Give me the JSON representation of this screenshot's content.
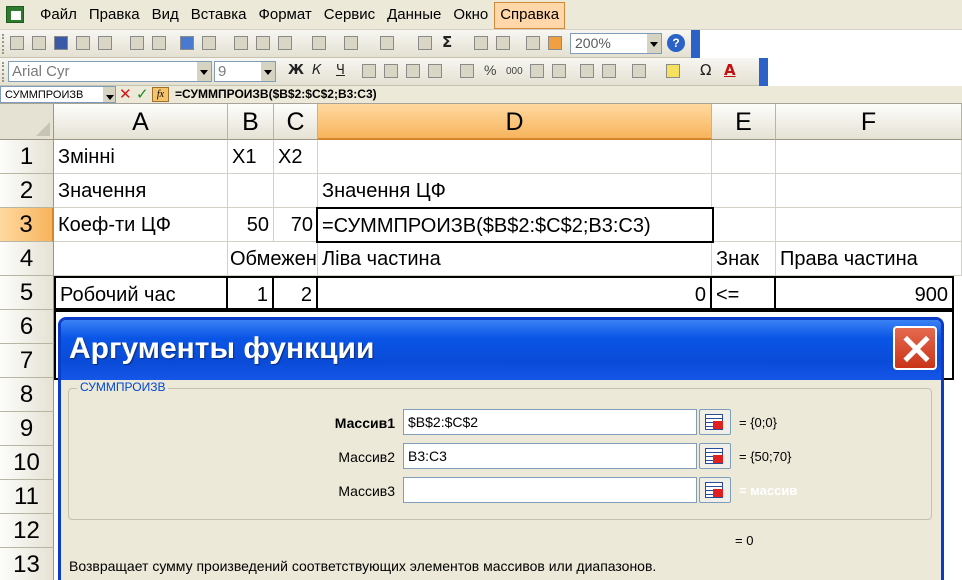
{
  "menu": {
    "items": [
      "Файл",
      "Правка",
      "Вид",
      "Вставка",
      "Формат",
      "Сервис",
      "Данные",
      "Окно",
      "Справка"
    ],
    "active": "Справка"
  },
  "toolbar": {
    "zoom": "200%",
    "help": "?",
    "font_name": "Arial Cyr",
    "font_size": "9",
    "bold_label": "Ж",
    "italic_label": "К",
    "underline_label": "Ч",
    "sigma": "Σ",
    "percent": "%",
    "thousands": "000",
    "omega": "Ω",
    "font_color_letter": "A"
  },
  "formula_bar": {
    "name_box": "СУММПРОИЗВ",
    "cancel_symbol": "✕",
    "ok_symbol": "✓",
    "fx_label": "fx",
    "formula": "=СУММПРОИЗВ($B$2:$C$2;B3:C3)"
  },
  "sheet": {
    "columns": [
      "A",
      "B",
      "C",
      "D",
      "E",
      "F"
    ],
    "selected_column": "D",
    "rows": [
      "1",
      "2",
      "3",
      "4",
      "5",
      "6",
      "7",
      "8",
      "9",
      "10",
      "11",
      "12",
      "13"
    ],
    "selected_row": "3",
    "cells": {
      "A1": "Змінні",
      "B1": "X1",
      "C1": "X2",
      "A2": "Значення",
      "D2": "Значення ЦФ",
      "A3": "Коеф-ти ЦФ",
      "B3": "50",
      "C3": "70",
      "D3": "=СУММПРОИЗВ($B$2:$C$2;B3:C3)",
      "B4": "Обмеження",
      "D4": "Ліва частина",
      "E4": "Знак",
      "F4": "Права частина",
      "A5": "Робочий час",
      "B5": "1",
      "C5": "2",
      "D5": "0",
      "E5": "<=",
      "F5": "900"
    }
  },
  "dialog": {
    "title": "Аргументы функции",
    "function_name": "СУММПРОИЗВ",
    "args": [
      {
        "label": "Массив1",
        "value": "$B$2:$C$2",
        "result": "= {0;0}",
        "bold": true
      },
      {
        "label": "Массив2",
        "value": "B3:C3",
        "result": "= {50;70}",
        "bold": false
      },
      {
        "label": "Массив3",
        "value": "",
        "result": "= массив",
        "bold": false
      }
    ],
    "result": "= 0",
    "description": "Возвращает сумму произведений соответствующих элементов массивов или диапазонов."
  }
}
